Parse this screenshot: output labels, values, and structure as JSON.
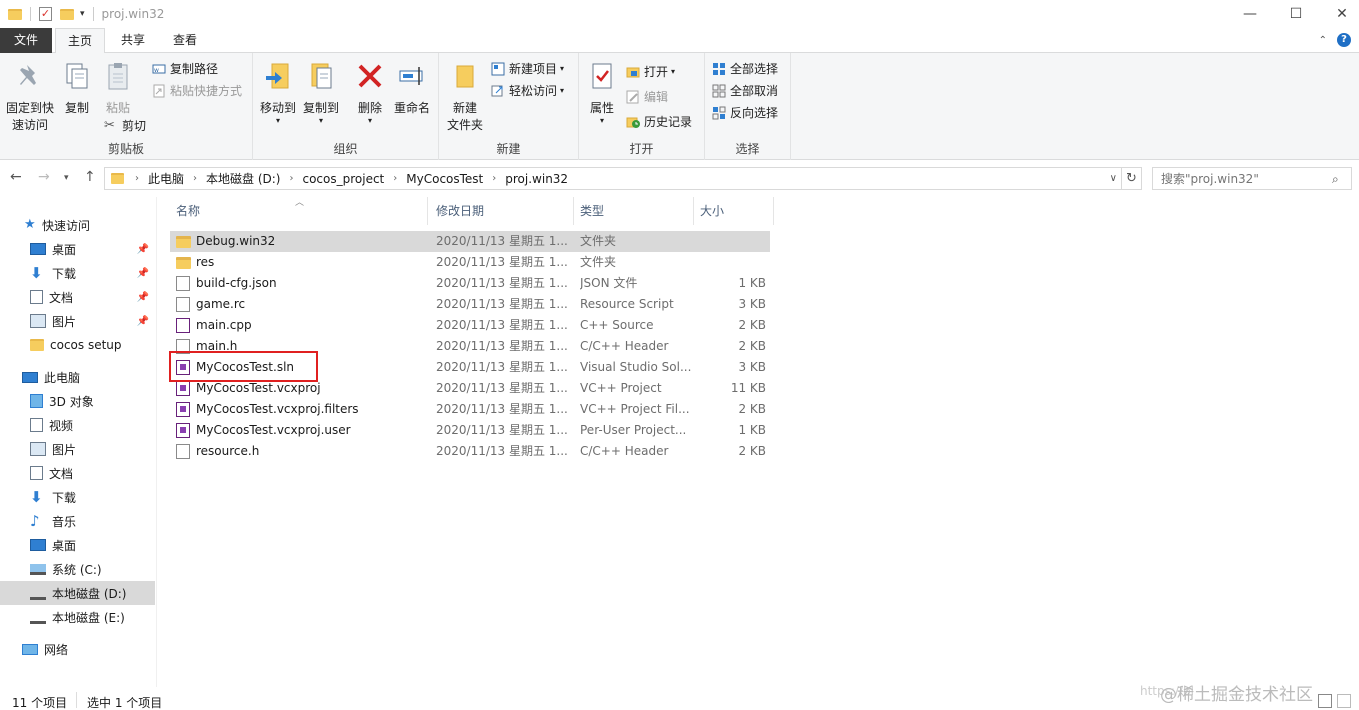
{
  "window": {
    "title": "proj.win32",
    "minimize_glyph": "—",
    "maximize_glyph": "☐",
    "close_glyph": "✕"
  },
  "ribbon_tabs": [
    "文件",
    "主页",
    "共享",
    "查看"
  ],
  "ribbon": {
    "clipboard": {
      "label": "剪贴板",
      "pin_quick_access": "固定到快速访问",
      "pin_line1": "固定到快",
      "pin_line2": "速访问",
      "copy": "复制",
      "paste": "粘贴",
      "copy_path": "复制路径",
      "paste_shortcut": "粘贴快捷方式",
      "cut": "剪切"
    },
    "organize": {
      "label": "组织",
      "move_to": "移动到",
      "copy_to": "复制到",
      "delete": "删除",
      "rename": "重命名"
    },
    "new": {
      "label": "新建",
      "new_folder_line1": "新建",
      "new_folder_line2": "文件夹",
      "new_item": "新建项目",
      "easy_access": "轻松访问"
    },
    "open": {
      "label": "打开",
      "properties": "属性",
      "open": "打开",
      "edit": "编辑",
      "history": "历史记录"
    },
    "select": {
      "label": "选择",
      "select_all": "全部选择",
      "select_none": "全部取消",
      "invert_selection": "反向选择"
    }
  },
  "address": {
    "breadcrumbs": [
      "此电脑",
      "本地磁盘 (D:)",
      "cocos_project",
      "MyCocosTest",
      "proj.win32"
    ],
    "search_placeholder": "搜索\"proj.win32\""
  },
  "nav": {
    "quick_access": "快速访问",
    "quick_items": [
      "桌面",
      "下载",
      "文档",
      "图片",
      "cocos setup"
    ],
    "this_pc": "此电脑",
    "pc_items": [
      "3D 对象",
      "视频",
      "图片",
      "文档",
      "下载",
      "音乐",
      "桌面",
      "系统 (C:)",
      "本地磁盘 (D:)",
      "本地磁盘 (E:)"
    ],
    "network": "网络"
  },
  "columns": {
    "name": "名称",
    "date": "修改日期",
    "type": "类型",
    "size": "大小"
  },
  "files": [
    {
      "name": "Debug.win32",
      "date": "2020/11/13 星期五 1...",
      "type": "文件夹",
      "size": "",
      "icon": "folder"
    },
    {
      "name": "res",
      "date": "2020/11/13 星期五 1...",
      "type": "文件夹",
      "size": "",
      "icon": "folder"
    },
    {
      "name": "build-cfg.json",
      "date": "2020/11/13 星期五 1...",
      "type": "JSON 文件",
      "size": "1 KB",
      "icon": "doc"
    },
    {
      "name": "game.rc",
      "date": "2020/11/13 星期五 1...",
      "type": "Resource Script",
      "size": "3 KB",
      "icon": "doc"
    },
    {
      "name": "main.cpp",
      "date": "2020/11/13 星期五 1...",
      "type": "C++ Source",
      "size": "2 KB",
      "icon": "cpp"
    },
    {
      "name": "main.h",
      "date": "2020/11/13 星期五 1...",
      "type": "C/C++ Header",
      "size": "2 KB",
      "icon": "doc"
    },
    {
      "name": "MyCocosTest.sln",
      "date": "2020/11/13 星期五 1...",
      "type": "Visual Studio Sol...",
      "size": "3 KB",
      "icon": "vs"
    },
    {
      "name": "MyCocosTest.vcxproj",
      "date": "2020/11/13 星期五 1...",
      "type": "VC++ Project",
      "size": "11 KB",
      "icon": "vs"
    },
    {
      "name": "MyCocosTest.vcxproj.filters",
      "date": "2020/11/13 星期五 1...",
      "type": "VC++ Project Fil...",
      "size": "2 KB",
      "icon": "vs"
    },
    {
      "name": "MyCocosTest.vcxproj.user",
      "date": "2020/11/13 星期五 1...",
      "type": "Per-User Project...",
      "size": "1 KB",
      "icon": "vs"
    },
    {
      "name": "resource.h",
      "date": "2020/11/13 星期五 1...",
      "type": "C/C++ Header",
      "size": "2 KB",
      "icon": "doc"
    }
  ],
  "status": {
    "item_count": "11 个项目",
    "selected": "选中 1 个项目"
  },
  "watermark": "@稀土掘金技术社区",
  "watermark_url": "https://bl",
  "colors": {
    "selection_gray": "#d9d9d9",
    "highlight_red": "#e02020",
    "folder_yellow": "#f6cd5e",
    "header_text": "#4c607a"
  }
}
